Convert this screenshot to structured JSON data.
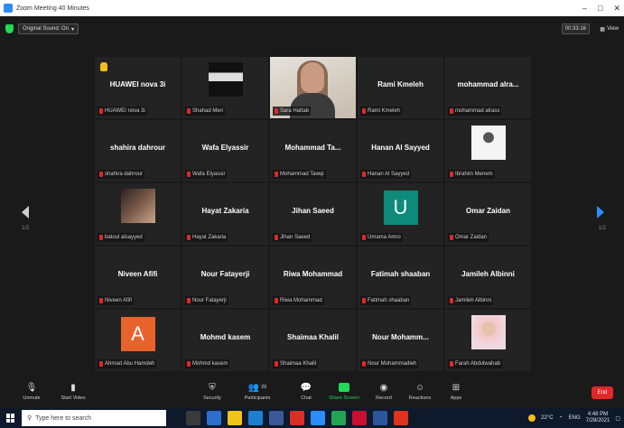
{
  "window": {
    "title": "Zoom Meeting 40 Minutes",
    "controls": [
      "–",
      "□",
      "✕"
    ]
  },
  "topbar": {
    "sound_label": "Original Sound: On",
    "timer": "00:33:16",
    "view_label": "View"
  },
  "participants": [
    {
      "name": "HUAWEI nova 3i",
      "label": "HUAWEI nova 3i",
      "hand": true
    },
    {
      "name": "",
      "label": "Shahad Meri",
      "image": "keyboard-photo"
    },
    {
      "name": "",
      "label": "Sara Hattab",
      "video": true,
      "active": true
    },
    {
      "name": "Rami Kmeleh",
      "label": "Rami Kmeleh"
    },
    {
      "name": "mohammad alra...",
      "label": "mohammad alrass"
    },
    {
      "name": "shahira dahrour",
      "label": "shahira dahrour"
    },
    {
      "name": "Wafa Elyassir",
      "label": "Wafa Elyassir"
    },
    {
      "name": "Mohammad Ta...",
      "label": "Mohammad Tawqi"
    },
    {
      "name": "Hanan Al Sayyed",
      "label": "Hanan Al Sayyed"
    },
    {
      "name": "",
      "label": "Ibrahim Menem",
      "image": "menem-logo"
    },
    {
      "name": "",
      "label": "batoul alsayyed",
      "image": "street-photo"
    },
    {
      "name": "Hayat Zakaria",
      "label": "Hayat Zakaria"
    },
    {
      "name": "Jihan Saeed",
      "label": "Jihan Saeed"
    },
    {
      "name": "",
      "label": "Umama Amro",
      "letter": "U",
      "letter_color": "#0e8a7a"
    },
    {
      "name": "Omar Zaidan",
      "label": "Omar Zaidan"
    },
    {
      "name": "Niveen Afifi",
      "label": "Niveen Afifi"
    },
    {
      "name": "Nour Fatayerji",
      "label": "Nour Fatayerji"
    },
    {
      "name": "Riwa Mohammad",
      "label": "Riwa Mohammad"
    },
    {
      "name": "Fatimah shaaban",
      "label": "Fatimah shaaban"
    },
    {
      "name": "Jamileh Albinni",
      "label": "Jamileh Albinni"
    },
    {
      "name": "",
      "label": "Ahmad Abu Hamdeh",
      "letter": "A",
      "letter_color": "#e8622b"
    },
    {
      "name": "Mohmd kasem",
      "label": "Mohmd kasem"
    },
    {
      "name": "Shaimaa Khalil",
      "label": "Shaimaa Khalil"
    },
    {
      "name": "Nour Mohamm...",
      "label": "Nour Mohammadieh"
    },
    {
      "name": "",
      "label": "Farah Abdulwahab",
      "image": "hijab-photo"
    }
  ],
  "nav": {
    "left_page": "1/2",
    "right_page": "1/2"
  },
  "toolbar": {
    "unmute": "Unmute",
    "start_video": "Start Video",
    "security": "Security",
    "participants": "Participants",
    "participants_count": "25",
    "chat": "Chat",
    "share_screen": "Share Screen",
    "record": "Record",
    "reactions": "Reactions",
    "apps": "Apps",
    "end": "End"
  },
  "taskbar": {
    "search_placeholder": "Type here to search",
    "weather": "22°C",
    "lang": "ENG",
    "time": "4:48 PM",
    "date": "7/28/2021"
  },
  "colors": {
    "accent_blue": "#2d8cff",
    "share_green": "#23d959",
    "end_red": "#e02828",
    "speaker_outline": "#c8d43a"
  }
}
